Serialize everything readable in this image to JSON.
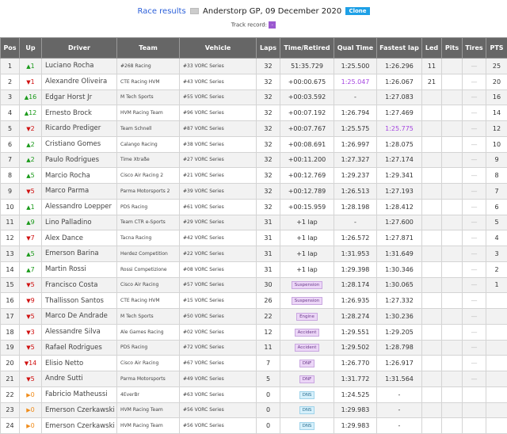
{
  "header": {
    "link": "Race results",
    "title": "Anderstorp GP, 09 December 2020",
    "clone": "Clone",
    "track_record_label": "Track record:",
    "track_record_value": "-"
  },
  "columns": [
    "Pos",
    "Up",
    "Driver",
    "Team",
    "Vehicle",
    "Laps",
    "Time/Retired",
    "Qual Time",
    "Fastest lap",
    "Led",
    "Pits",
    "Tires",
    "PTS"
  ],
  "colors": {
    "up": "#1a9a1a",
    "down": "#d01010",
    "same": "#f08c1a",
    "best": "#a545e0"
  },
  "rows": [
    {
      "pos": "1",
      "dir": "up",
      "chg": "1",
      "driver": "Luciano Rocha",
      "team": "#268 Racing",
      "vehicle": "#33 VORC Series",
      "laps": "32",
      "time": "51:35.729",
      "qual": "1:25.500",
      "fast": "1:26.296",
      "led": "11",
      "pits": "",
      "tires": "—",
      "pts": "25"
    },
    {
      "pos": "2",
      "dir": "down",
      "chg": "1",
      "driver": "Alexandre Oliveira",
      "team": "CTE Racing HVM",
      "vehicle": "#43 VORC Series",
      "laps": "32",
      "time": "+00:00.675",
      "qual": "1:25.047",
      "qual_best": true,
      "fast": "1:26.067",
      "led": "21",
      "pits": "",
      "tires": "—",
      "pts": "20"
    },
    {
      "pos": "3",
      "dir": "up",
      "chg": "16",
      "driver": "Edgar Horst Jr",
      "team": "M Tech Sports",
      "vehicle": "#55 VORC Series",
      "laps": "32",
      "time": "+00:03.592",
      "qual": "-",
      "fast": "1:27.083",
      "led": "",
      "pits": "",
      "tires": "—",
      "pts": "16"
    },
    {
      "pos": "4",
      "dir": "up",
      "chg": "12",
      "driver": "Ernesto Brock",
      "team": "HVM Racing Team",
      "vehicle": "#96 VORC Series",
      "laps": "32",
      "time": "+00:07.192",
      "qual": "1:26.794",
      "fast": "1:27.469",
      "led": "",
      "pits": "",
      "tires": "—",
      "pts": "14"
    },
    {
      "pos": "5",
      "dir": "down",
      "chg": "2",
      "driver": "Ricardo Prediger",
      "team": "Team Schnell",
      "vehicle": "#87 VORC Series",
      "laps": "32",
      "time": "+00:07.767",
      "qual": "1:25.575",
      "fast": "1:25.775",
      "fast_best": true,
      "led": "",
      "pits": "",
      "tires": "—",
      "pts": "12"
    },
    {
      "pos": "6",
      "dir": "up",
      "chg": "2",
      "driver": "Cristiano Gomes",
      "team": "Calango Racing",
      "vehicle": "#38 VORC Series",
      "laps": "32",
      "time": "+00:08.691",
      "qual": "1:26.997",
      "fast": "1:28.075",
      "led": "",
      "pits": "",
      "tires": "—",
      "pts": "10"
    },
    {
      "pos": "7",
      "dir": "up",
      "chg": "2",
      "driver": "Paulo Rodrigues",
      "team": "Time Xtraße",
      "vehicle": "#27 VORC Series",
      "laps": "32",
      "time": "+00:11.200",
      "qual": "1:27.327",
      "fast": "1:27.174",
      "led": "",
      "pits": "",
      "tires": "—",
      "pts": "9"
    },
    {
      "pos": "8",
      "dir": "up",
      "chg": "5",
      "driver": "Marcio Rocha",
      "team": "Cisco Air Racing 2",
      "vehicle": "#21 VORC Series",
      "laps": "32",
      "time": "+00:12.769",
      "qual": "1:29.237",
      "fast": "1:29.341",
      "led": "",
      "pits": "",
      "tires": "—",
      "pts": "8"
    },
    {
      "pos": "9",
      "dir": "down",
      "chg": "5",
      "driver": "Marco Parma",
      "team": "Parma Motorsports 2",
      "vehicle": "#39 VORC Series",
      "laps": "32",
      "time": "+00:12.789",
      "qual": "1:26.513",
      "fast": "1:27.193",
      "led": "",
      "pits": "",
      "tires": "—",
      "pts": "7"
    },
    {
      "pos": "10",
      "dir": "up",
      "chg": "1",
      "driver": "Alessandro Loepper",
      "team": "PDS Racing",
      "vehicle": "#61 VORC Series",
      "laps": "32",
      "time": "+00:15.959",
      "qual": "1:28.198",
      "fast": "1:28.412",
      "led": "",
      "pits": "",
      "tires": "—",
      "pts": "6"
    },
    {
      "pos": "11",
      "dir": "up",
      "chg": "9",
      "driver": "Lino Palladino",
      "team": "Team CTR e-Sports",
      "vehicle": "#29 VORC Series",
      "laps": "31",
      "time": "+1 lap",
      "qual": "-",
      "fast": "1:27.600",
      "led": "",
      "pits": "",
      "tires": "—",
      "pts": "5"
    },
    {
      "pos": "12",
      "dir": "down",
      "chg": "7",
      "driver": "Alex Dance",
      "team": "Tacna Racing",
      "vehicle": "#42 VORC Series",
      "laps": "31",
      "time": "+1 lap",
      "qual": "1:26.572",
      "fast": "1:27.871",
      "led": "",
      "pits": "",
      "tires": "—",
      "pts": "4"
    },
    {
      "pos": "13",
      "dir": "up",
      "chg": "5",
      "driver": "Emerson Barina",
      "team": "Herdez Competition",
      "vehicle": "#22 VORC Series",
      "laps": "31",
      "time": "+1 lap",
      "qual": "1:31.953",
      "fast": "1:31.649",
      "led": "",
      "pits": "",
      "tires": "—",
      "pts": "3"
    },
    {
      "pos": "14",
      "dir": "up",
      "chg": "7",
      "driver": "Martin Rossi",
      "team": "Rossi Competizione",
      "vehicle": "#08 VORC Series",
      "laps": "31",
      "time": "+1 lap",
      "qual": "1:29.398",
      "fast": "1:30.346",
      "led": "",
      "pits": "",
      "tires": "—",
      "pts": "2"
    },
    {
      "pos": "15",
      "dir": "down",
      "chg": "5",
      "driver": "Francisco Costa",
      "team": "Cisco Air Racing",
      "vehicle": "#57 VORC Series",
      "laps": "30",
      "badge": "Suspension",
      "qual": "1:28.174",
      "fast": "1:30.065",
      "led": "",
      "pits": "",
      "tires": "—",
      "pts": "1"
    },
    {
      "pos": "16",
      "dir": "down",
      "chg": "9",
      "driver": "Thallisson Santos",
      "team": "CTE Racing HVM",
      "vehicle": "#15 VORC Series",
      "laps": "26",
      "badge": "Suspension",
      "qual": "1:26.935",
      "fast": "1:27.332",
      "led": "",
      "pits": "",
      "tires": "—",
      "pts": ""
    },
    {
      "pos": "17",
      "dir": "down",
      "chg": "5",
      "driver": "Marco De Andrade",
      "team": "M Tech Sports",
      "vehicle": "#50 VORC Series",
      "laps": "22",
      "badge": "Engine",
      "qual": "1:28.274",
      "fast": "1:30.236",
      "led": "",
      "pits": "",
      "tires": "—",
      "pts": ""
    },
    {
      "pos": "18",
      "dir": "down",
      "chg": "3",
      "driver": "Alessandre Silva",
      "team": "Ale Games Racing",
      "vehicle": "#02 VORC Series",
      "laps": "12",
      "badge": "Accident",
      "qual": "1:29.551",
      "fast": "1:29.205",
      "led": "",
      "pits": "",
      "tires": "—",
      "pts": ""
    },
    {
      "pos": "19",
      "dir": "down",
      "chg": "5",
      "driver": "Rafael Rodrigues",
      "team": "PDS Racing",
      "vehicle": "#72 VORC Series",
      "laps": "11",
      "badge": "Accident",
      "qual": "1:29.502",
      "fast": "1:28.798",
      "led": "",
      "pits": "",
      "tires": "—",
      "pts": ""
    },
    {
      "pos": "20",
      "dir": "down",
      "chg": "14",
      "driver": "Elisio Netto",
      "team": "Cisco Air Racing",
      "vehicle": "#67 VORC Series",
      "laps": "7",
      "badge": "DNF",
      "qual": "1:26.770",
      "fast": "1:26.917",
      "led": "",
      "pits": "",
      "tires": "—",
      "pts": ""
    },
    {
      "pos": "21",
      "dir": "down",
      "chg": "5",
      "driver": "Andre Sutti",
      "team": "Parma Motorsports",
      "vehicle": "#49 VORC Series",
      "laps": "5",
      "badge": "DNF",
      "qual": "1:31.772",
      "fast": "1:31.564",
      "led": "",
      "pits": "",
      "tires": "—",
      "pts": ""
    },
    {
      "pos": "22",
      "dir": "same",
      "chg": "0",
      "driver": "Fabricio Matheussi",
      "team": "4EverBr",
      "vehicle": "#63 VORC Series",
      "laps": "0",
      "badge": "DNS",
      "qual": "1:24.525",
      "fast": "-",
      "led": "",
      "pits": "",
      "tires": "",
      "pts": ""
    },
    {
      "pos": "23",
      "dir": "same",
      "chg": "0",
      "driver": "Emerson Czerkawski",
      "team": "HVM Racing Team",
      "vehicle": "#56 VORC Series",
      "laps": "0",
      "badge": "DNS",
      "qual": "1:29.983",
      "fast": "-",
      "led": "",
      "pits": "",
      "tires": "",
      "pts": ""
    },
    {
      "pos": "24",
      "dir": "same",
      "chg": "0",
      "driver": "Emerson Czerkawski",
      "team": "HVM Racing Team",
      "vehicle": "#56 VORC Series",
      "laps": "0",
      "badge": "DNS",
      "qual": "1:29.983",
      "fast": "-",
      "led": "",
      "pits": "",
      "tires": "",
      "pts": ""
    }
  ]
}
